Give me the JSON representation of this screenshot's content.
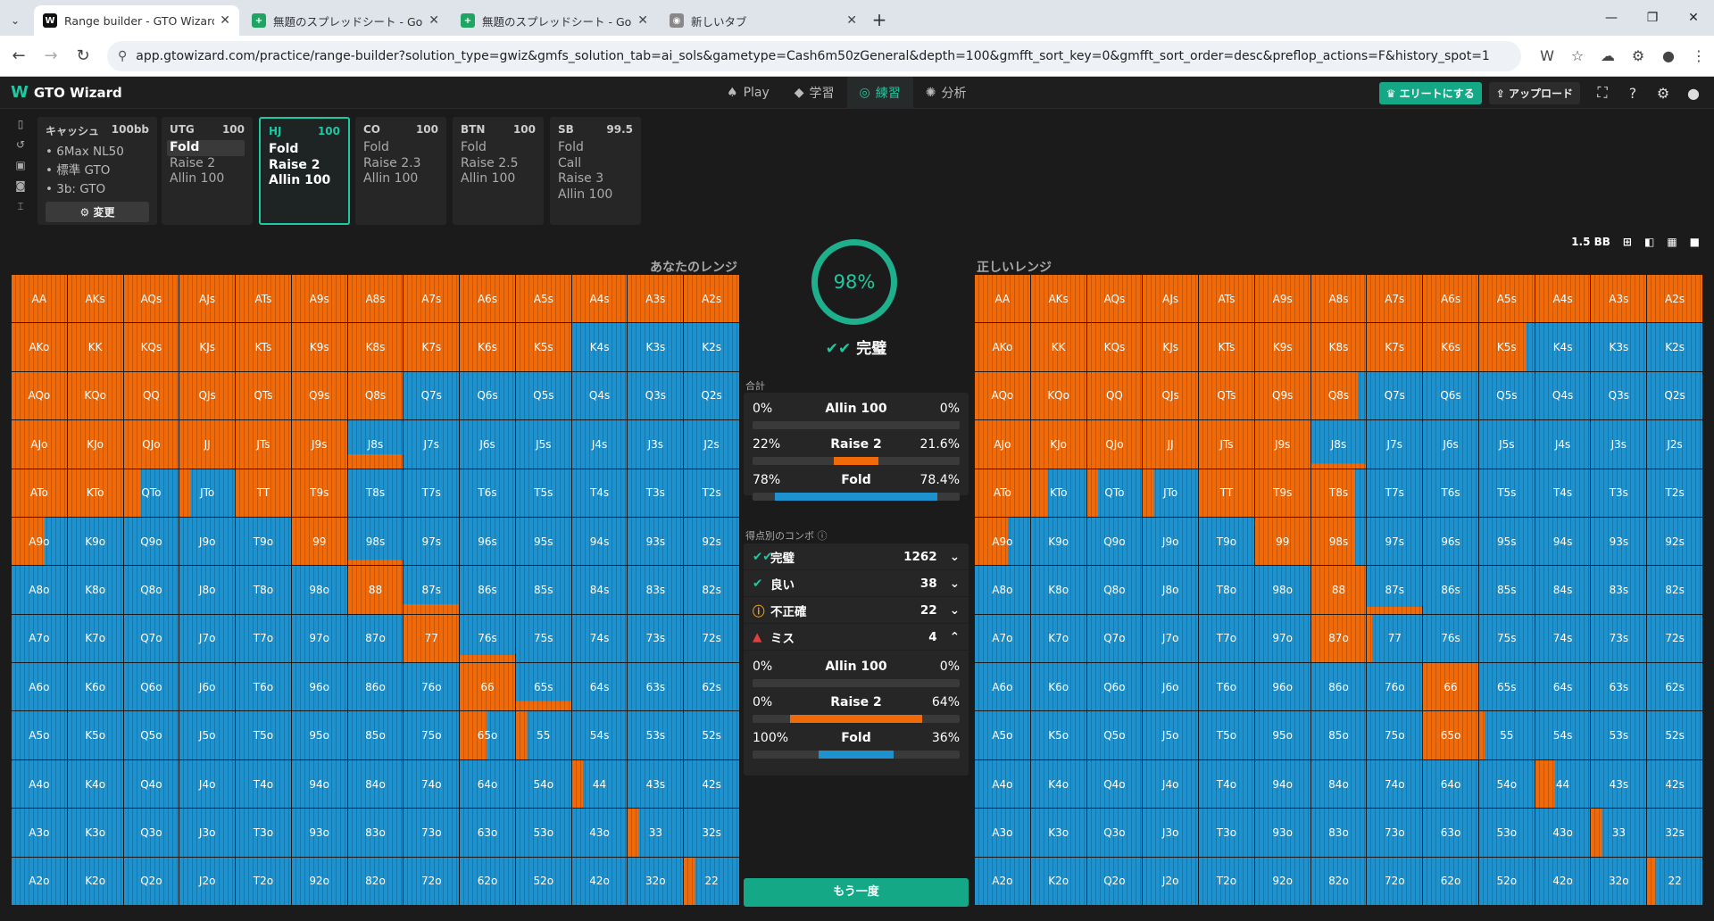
{
  "browser": {
    "tabs": [
      {
        "title": "Range builder - GTO Wizard",
        "icon": "W",
        "color": "#111111"
      },
      {
        "title": "無題のスプレッドシート - Google ス",
        "icon": "+",
        "color": "#1fa463"
      },
      {
        "title": "無題のスプレッドシート - Google ス",
        "icon": "+",
        "color": "#1fa463"
      },
      {
        "title": "新しいタブ",
        "icon": "◉",
        "color": "#888888"
      }
    ],
    "url": "app.gtowizard.com/practice/range-builder?solution_type=gwiz&gmfs_solution_tab=ai_sols&gametype=Cash6m50zGeneral&depth=100&gmfft_sort_key=0&gmfft_sort_order=desc&preflop_actions=F&history_spot=1"
  },
  "app": {
    "logo": "GTO Wizard",
    "nav": [
      {
        "icon": "♠",
        "label": "Play"
      },
      {
        "icon": "◆",
        "label": "学習"
      },
      {
        "icon": "◎",
        "label": "練習"
      },
      {
        "icon": "✺",
        "label": "分析"
      }
    ],
    "elite": "♛ エリートにする",
    "upload": "⇪ アップロード"
  },
  "game": {
    "title": "キャッシュ",
    "depth": "100bb",
    "items": [
      "6Max NL50",
      "標準 GTO",
      "3b: GTO"
    ],
    "change": "⚙ 変更"
  },
  "positions": [
    {
      "name": "UTG",
      "stack": "100",
      "actions": [
        "Fold",
        "Raise 2",
        "Allin 100"
      ]
    },
    {
      "name": "HJ",
      "stack": "100",
      "actions": [
        "Fold",
        "Raise 2",
        "Allin 100"
      ]
    },
    {
      "name": "CO",
      "stack": "100",
      "actions": [
        "Fold",
        "Raise 2.3",
        "Allin 100"
      ]
    },
    {
      "name": "BTN",
      "stack": "100",
      "actions": [
        "Fold",
        "Raise 2.5",
        "Allin 100"
      ]
    },
    {
      "name": "SB",
      "stack": "99.5",
      "actions": [
        "Fold",
        "Call",
        "Raise 3",
        "Allin 100"
      ]
    }
  ],
  "view": {
    "bb": "1.5 BB"
  },
  "labels": {
    "your_range": "あなたのレンジ",
    "correct_range": "正しいレンジ"
  },
  "result": {
    "score": "98%",
    "verdict": "完璧",
    "total_label": "合計",
    "totals": [
      {
        "l": "0%",
        "name": "Allin  100",
        "r": "0%",
        "you": 0,
        "gto": 0,
        "color": "#c0392b"
      },
      {
        "l": "22%",
        "name": "Raise  2",
        "r": "21.6%",
        "you": 22,
        "gto": 21.6,
        "color": "#f06a0a"
      },
      {
        "l": "78%",
        "name": "Fold",
        "r": "78.4%",
        "you": 78,
        "gto": 78.4,
        "color": "#1d92cf"
      }
    ],
    "combo_label": "得点別のコンボ ⓘ",
    "combos": [
      {
        "icon": "✔✔",
        "name": "完璧",
        "count": "1262",
        "arrow": "⌄",
        "color": "#1ec8a0"
      },
      {
        "icon": "✔",
        "name": "良い",
        "count": "38",
        "arrow": "⌄",
        "color": "#1ec8a0"
      },
      {
        "icon": "ⓘ",
        "name": "不正確",
        "count": "22",
        "arrow": "⌄",
        "color": "#f0a020"
      },
      {
        "icon": "▲",
        "name": "ミス",
        "count": "4",
        "arrow": "⌃",
        "color": "#e04040"
      }
    ],
    "mistakes": [
      {
        "l": "0%",
        "name": "Allin  100",
        "r": "0%",
        "you": 0,
        "gto": 0,
        "color": "#c0392b"
      },
      {
        "l": "0%",
        "name": "Raise  2",
        "r": "64%",
        "you": 0,
        "gto": 64,
        "color": "#f06a0a"
      },
      {
        "l": "100%",
        "name": "Fold",
        "r": "36%",
        "you": 100,
        "gto": 36,
        "color": "#1d92cf"
      }
    ],
    "again": "もう一度"
  },
  "range_colors": {
    "raise": "#f06a0a",
    "fold": "#1d92cf"
  },
  "your_range": [
    [
      1,
      1,
      1,
      1,
      1,
      1,
      1,
      1,
      1,
      1,
      1,
      1,
      1
    ],
    [
      1,
      1,
      1,
      1,
      1,
      1,
      1,
      1,
      1,
      1,
      0,
      0,
      0
    ],
    [
      1,
      1,
      1,
      1,
      1,
      1,
      1,
      0,
      0,
      0,
      0,
      0,
      0
    ],
    [
      1,
      1,
      1,
      1,
      1,
      1,
      0.3,
      0,
      0,
      0,
      0,
      0,
      0
    ],
    [
      1,
      1,
      0.3,
      0.2,
      1,
      1,
      0,
      0,
      0,
      0,
      0,
      0,
      0
    ],
    [
      0.6,
      0,
      0,
      0,
      0,
      1,
      0.1,
      0,
      0,
      0,
      0,
      0,
      0
    ],
    [
      0,
      0,
      0,
      0,
      0,
      0,
      1,
      0.2,
      0,
      0,
      0,
      0,
      0
    ],
    [
      0,
      0,
      0,
      0,
      0,
      0,
      0,
      1,
      0.15,
      0,
      0,
      0,
      0
    ],
    [
      0,
      0,
      0,
      0,
      0,
      0,
      0,
      0,
      1,
      0.2,
      0,
      0,
      0
    ],
    [
      0,
      0,
      0,
      0,
      0,
      0,
      0,
      0,
      0.5,
      0.2,
      0,
      0,
      0
    ],
    [
      0,
      0,
      0,
      0,
      0,
      0,
      0,
      0,
      0,
      0,
      0.2,
      0,
      0
    ],
    [
      0,
      0,
      0,
      0,
      0,
      0,
      0,
      0,
      0,
      0,
      0,
      0.2,
      0
    ],
    [
      0,
      0,
      0,
      0,
      0,
      0,
      0,
      0,
      0,
      0,
      0,
      0,
      0.2
    ]
  ],
  "correct_range": [
    [
      1,
      1,
      1,
      1,
      1,
      1,
      1,
      1,
      1,
      1,
      1,
      1,
      1
    ],
    [
      1,
      1,
      1,
      1,
      1,
      1,
      1,
      1,
      1,
      0.85,
      0,
      0,
      0
    ],
    [
      1,
      1,
      1,
      1,
      1,
      1,
      0.85,
      0,
      0,
      0,
      0,
      0,
      0
    ],
    [
      1,
      1,
      1,
      1,
      1,
      1,
      0.1,
      0,
      0,
      0,
      0,
      0,
      0
    ],
    [
      1,
      0.3,
      0.2,
      0.2,
      1,
      1,
      0.8,
      0,
      0,
      0,
      0,
      0,
      0
    ],
    [
      0.6,
      0,
      0,
      0,
      0,
      1,
      0.8,
      0,
      0,
      0,
      0,
      0,
      0
    ],
    [
      0,
      0,
      0,
      0,
      0,
      0,
      1,
      0.15,
      0,
      0,
      0,
      0,
      0
    ],
    [
      0,
      0,
      0,
      0,
      0,
      0,
      1,
      0.1,
      0,
      0,
      0,
      0,
      0
    ],
    [
      0,
      0,
      0,
      0,
      0,
      0,
      0,
      0,
      1,
      0,
      0,
      0,
      0
    ],
    [
      0,
      0,
      0,
      0,
      0,
      0,
      0,
      0,
      1,
      0.1,
      0,
      0,
      0
    ],
    [
      0,
      0,
      0,
      0,
      0,
      0,
      0,
      0,
      0,
      0,
      0.35,
      0,
      0
    ],
    [
      0,
      0,
      0,
      0,
      0,
      0,
      0,
      0,
      0,
      0,
      0,
      0.2,
      0
    ],
    [
      0,
      0,
      0,
      0,
      0,
      0,
      0,
      0,
      0,
      0,
      0,
      0,
      0.15
    ]
  ]
}
